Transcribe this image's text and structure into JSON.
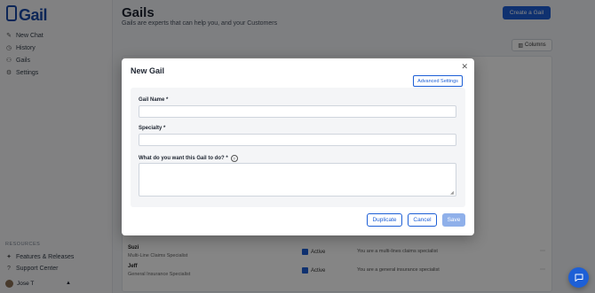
{
  "app": {
    "logo_text": "Gail"
  },
  "sidebar": {
    "items": [
      {
        "label": "New Chat",
        "icon": "pencil-icon"
      },
      {
        "label": "History",
        "icon": "clock-icon"
      },
      {
        "label": "Gails",
        "icon": "people-icon"
      },
      {
        "label": "Settings",
        "icon": "gear-icon"
      }
    ],
    "resources_label": "RESOURCES",
    "resource_items": [
      {
        "label": "Features & Releases",
        "icon": "sparkle-icon"
      },
      {
        "label": "Support Center",
        "icon": "help-icon"
      }
    ],
    "user_name": "Jose T"
  },
  "page": {
    "title": "Gails",
    "subtitle": "Gails are experts that can help you, and your Customers",
    "create_button": "Create a Gail",
    "columns_button": "Columns"
  },
  "table": {
    "rows": [
      {
        "name": "Suzi",
        "specialty": "Multi-Line Claims Specialist",
        "status": "Active",
        "description": "You are a multi-lines claims specialist"
      },
      {
        "name": "Jeff",
        "specialty": "General Insurance Specialist",
        "status": "Active",
        "description": "You are a general insurance specialist"
      }
    ]
  },
  "modal": {
    "title": "New Gail",
    "advanced_settings": "Advanced Settings",
    "fields": {
      "name_label": "Gail Name *",
      "name_value": "",
      "specialty_label": "Specialty *",
      "specialty_value": "",
      "task_label": "What do you want this Gail to do? *",
      "task_value": ""
    },
    "buttons": {
      "duplicate": "Duplicate",
      "cancel": "Cancel",
      "save": "Save"
    }
  },
  "colors": {
    "accent": "#1d5fd6",
    "save_disabled": "#8fb0ea",
    "overlay": "rgba(0,0,0,0.48)"
  }
}
